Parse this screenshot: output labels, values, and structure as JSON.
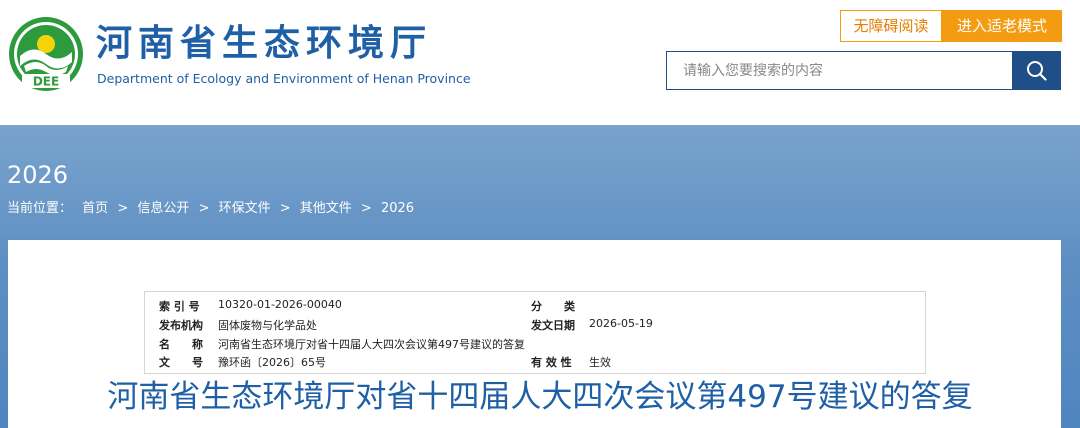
{
  "header": {
    "site_title": "河南省生态环境厅",
    "site_subtitle": "Department of Ecology and Environment of Henan Province",
    "logo_text": "DEE",
    "accessible_label": "无障碍阅读",
    "elder_mode_label": "进入适老模式",
    "search": {
      "placeholder": "请输入您要搜索的内容",
      "value": ""
    }
  },
  "banner": {
    "year": "2026",
    "breadcrumb": {
      "prefix": "当前位置：",
      "items": [
        "首页",
        "信息公开",
        "环保文件",
        "其他文件",
        "2026"
      ],
      "separator": ">"
    }
  },
  "meta": {
    "index_label": "索 引 号",
    "index_value": "10320-01-2026-00040",
    "category_label": "分　　类",
    "category_value": "",
    "issuer_label": "发布机构",
    "issuer_value": "固体废物与化学品处",
    "date_label": "发文日期",
    "date_value": "2026-05-19",
    "name_label": "名　　称",
    "name_value": "河南省生态环境厅对省十四届人大四次会议第497号建议的答复",
    "docno_label": "文　　号",
    "docno_value": "豫环函〔2026〕65号",
    "validity_label": "有 效 性",
    "validity_value": "生效"
  },
  "document": {
    "title": "河南省生态环境厅对省十四届人大四次会议第497号建议的答复"
  },
  "colors": {
    "brand_blue": "#1f5fa6",
    "search_blue": "#1f4f86",
    "accent_orange": "#f39c12",
    "logo_green": "#2e9a3e"
  }
}
